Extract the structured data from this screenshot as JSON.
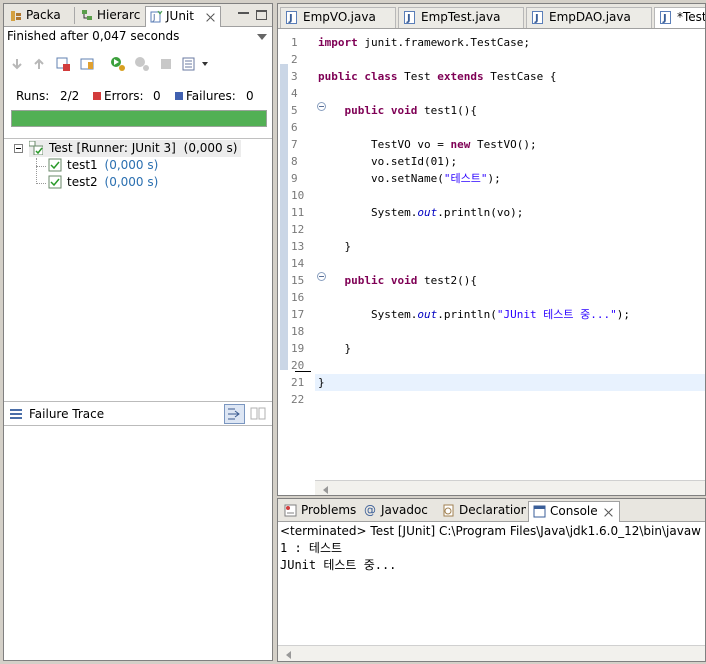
{
  "left_tabs": [
    {
      "label": "Packa",
      "icon": "package-explorer-icon"
    },
    {
      "label": "Hierarc",
      "icon": "hierarchy-icon"
    },
    {
      "label": "JUnit",
      "icon": "junit-icon"
    }
  ],
  "junit": {
    "status": "Finished after 0,047 seconds",
    "runs_label": "Runs:",
    "runs_value": "2/2",
    "errors_label": "Errors:",
    "errors_value": "0",
    "failures_label": "Failures:",
    "failures_value": "0",
    "progress": 1.0,
    "progress_color": "#52b054",
    "tree": {
      "root_label": "Test [Runner: JUnit 3]",
      "root_time": "(0,000 s)",
      "children": [
        {
          "label": "test1",
          "time": "(0,000 s)"
        },
        {
          "label": "test2",
          "time": "(0,000 s)"
        }
      ]
    },
    "failure_trace_title": "Failure Trace"
  },
  "editor": {
    "tabs": [
      {
        "label": "EmpVO.java"
      },
      {
        "label": "EmpTest.java"
      },
      {
        "label": "EmpDAO.java"
      },
      {
        "label": "*Test"
      }
    ],
    "line_numbers": [
      "1",
      "2",
      "3",
      "4",
      "5",
      "6",
      "7",
      "8",
      "9",
      "10",
      "11",
      "12",
      "13",
      "14",
      "15",
      "16",
      "17",
      "18",
      "19",
      "20",
      "21",
      "22"
    ],
    "code": {
      "l1_kw": "import",
      "l1_rest": " junit.framework.TestCase;",
      "l3_kw1": "public",
      "l3_kw2": "class",
      "l3_name": " Test ",
      "l3_kw3": "extends",
      "l3_rest": " TestCase {",
      "l5_kw1": "public",
      "l5_kw2": "void",
      "l5_rest": " test1(){",
      "l7_a": "TestVO vo = ",
      "l7_kw": "new",
      "l7_b": " TestVO();",
      "l8": "vo.setId(01);",
      "l9_a": "vo.setName(",
      "l9_str": "\"테스트\"",
      "l9_b": ");",
      "l11_a": "System.",
      "l11_fld": "out",
      "l11_b": ".println(vo);",
      "l13": "}",
      "l15_kw1": "public",
      "l15_kw2": "void",
      "l15_rest": " test2(){",
      "l17_a": "System.",
      "l17_fld": "out",
      "l17_b": ".println(",
      "l17_str": "\"JUnit 테스트 중...\"",
      "l17_c": ");",
      "l19": "}",
      "l21": "}"
    }
  },
  "console": {
    "tabs": [
      {
        "label": "Problems",
        "icon": "problems-icon"
      },
      {
        "label": "Javadoc",
        "icon": "javadoc-icon"
      },
      {
        "label": "Declaration",
        "icon": "declaration-icon"
      },
      {
        "label": "Console",
        "icon": "console-icon"
      }
    ],
    "status": "<terminated> Test [JUnit] C:\\Program Files\\Java\\jdk1.6.0_12\\bin\\javaw",
    "output": [
      "1 : 테스트",
      "JUnit 테스트 중..."
    ]
  }
}
